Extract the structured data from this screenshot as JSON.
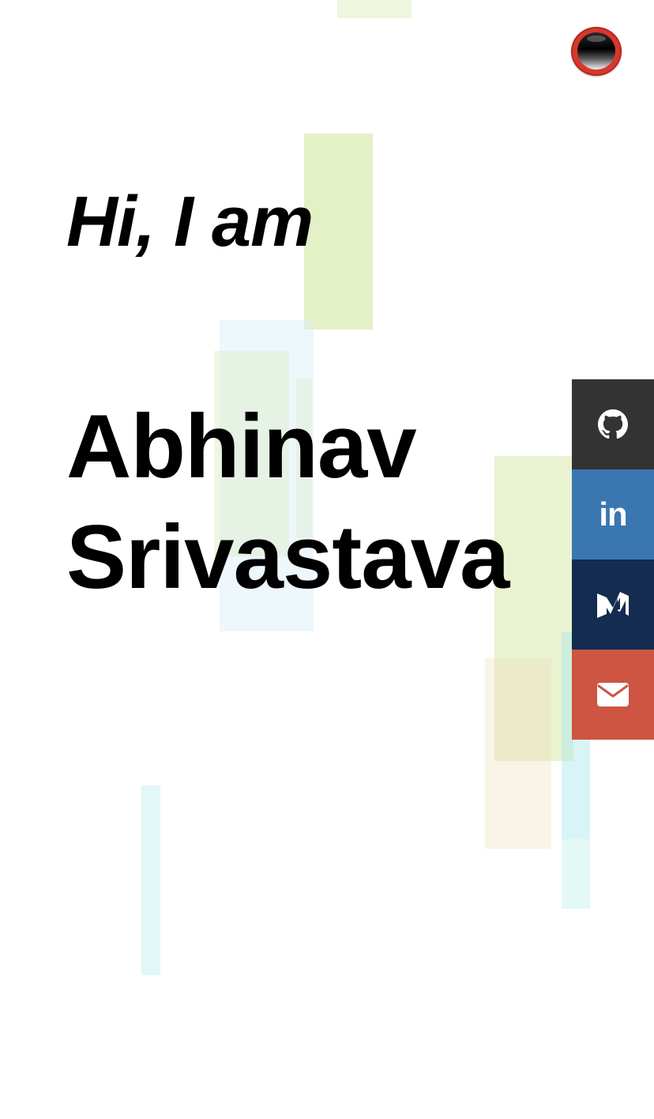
{
  "hero": {
    "greeting": "Hi, I am",
    "first_name": "Abhinav",
    "last_name": "Srivastava"
  },
  "menu_orb": {
    "icon": "orb-icon",
    "colors": {
      "ring": "#d8382c",
      "core": "#000000"
    }
  },
  "social": [
    {
      "id": "github",
      "icon": "github-icon",
      "color": "#333333"
    },
    {
      "id": "linkedin",
      "icon": "linkedin-icon",
      "label": "in",
      "color": "#3a77b1"
    },
    {
      "id": "medium",
      "icon": "medium-icon",
      "color": "#132c4f"
    },
    {
      "id": "email",
      "icon": "envelope-icon",
      "color": "#cd5542"
    }
  ],
  "colors": {
    "background": "#ffffff",
    "text": "#000000"
  }
}
